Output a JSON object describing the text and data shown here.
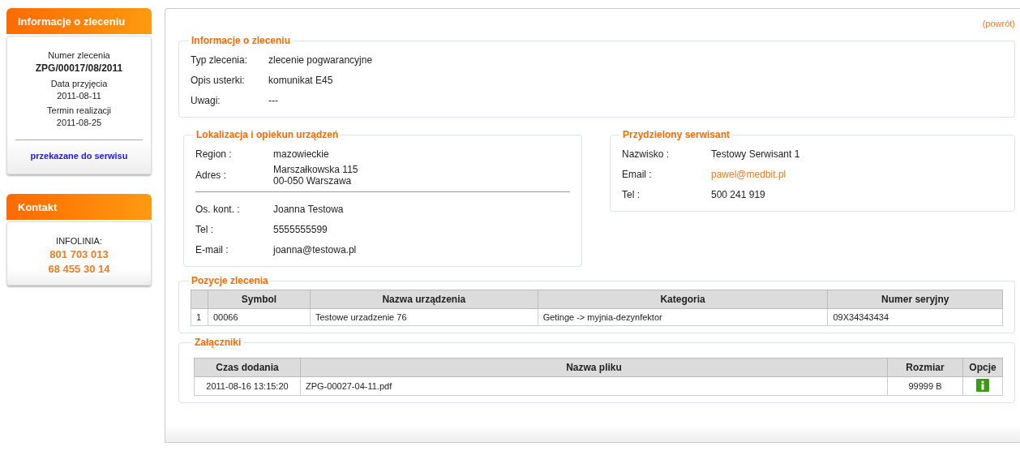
{
  "sidebar": {
    "order_panel": {
      "title": "Informacje o zleceniu",
      "fields": [
        {
          "label": "Numer zlecenia",
          "value": "ZPG/00017/08/2011",
          "kind": "bold"
        },
        {
          "label": "Data przyjęcia",
          "value": "2011-08-11",
          "kind": "plain"
        },
        {
          "label": "Termin realizacji",
          "value": "2011-08-25",
          "kind": "plain"
        }
      ],
      "status": "przekazane do serwisu"
    },
    "contact_panel": {
      "title": "Kontakt",
      "label": "INFOLINIA:",
      "phones": [
        "801 703 013",
        "68 455 30 14"
      ]
    }
  },
  "back_link": "(powrót)",
  "order_info": {
    "title": "Informacje o zleceniu",
    "rows": [
      {
        "label": "Typ zlecenia:",
        "value": "zlecenie pogwarancyjne"
      },
      {
        "label": "Opis usterki:",
        "value": "komunikat E45"
      },
      {
        "label": "Uwagi:",
        "value": "---"
      }
    ]
  },
  "location": {
    "title": "Lokalizacja i opiekun urządzeń",
    "rows": [
      {
        "label": "Region :",
        "value": [
          "mazowieckie"
        ]
      },
      {
        "label": "Adres :",
        "value": [
          "Marszałkowska 115",
          "00-050 Warszawa"
        ]
      }
    ],
    "contact_rows": [
      {
        "label": "Os. kont. :",
        "value": "Joanna Testowa"
      },
      {
        "label": "Tel :",
        "value": "5555555599"
      },
      {
        "label": "E-mail :",
        "value": "joanna@testowa.pl"
      }
    ]
  },
  "technician": {
    "title": "Przydzielony serwisant",
    "rows": [
      {
        "label": "Nazwisko :",
        "value": "Testowy Serwisant 1",
        "kind": "text"
      },
      {
        "label": "Email :",
        "value": "pawel@medbit.pl",
        "kind": "link"
      },
      {
        "label": "Tel :",
        "value": "500 241 919",
        "kind": "text"
      }
    ]
  },
  "items": {
    "title": "Pozycje zlecenia",
    "columns": [
      "Symbol",
      "Nazwa urządzenia",
      "Kategoria",
      "Numer seryjny"
    ],
    "rows": [
      {
        "number": "1",
        "cells": [
          "00066",
          "Testowe urzadzenie 76",
          "Getinge -> myjnia-dezynfektor",
          "09X34343434"
        ]
      }
    ]
  },
  "attachments": {
    "title": "Załączniki",
    "columns": [
      "Czas dodania",
      "Nazwa pliku",
      "Rozmiar",
      "Opcje"
    ],
    "rows": [
      {
        "time": "2011-08-16 13:15:20",
        "file": "ZPG-00027-04-11.pdf",
        "size": "99999 B"
      }
    ]
  }
}
